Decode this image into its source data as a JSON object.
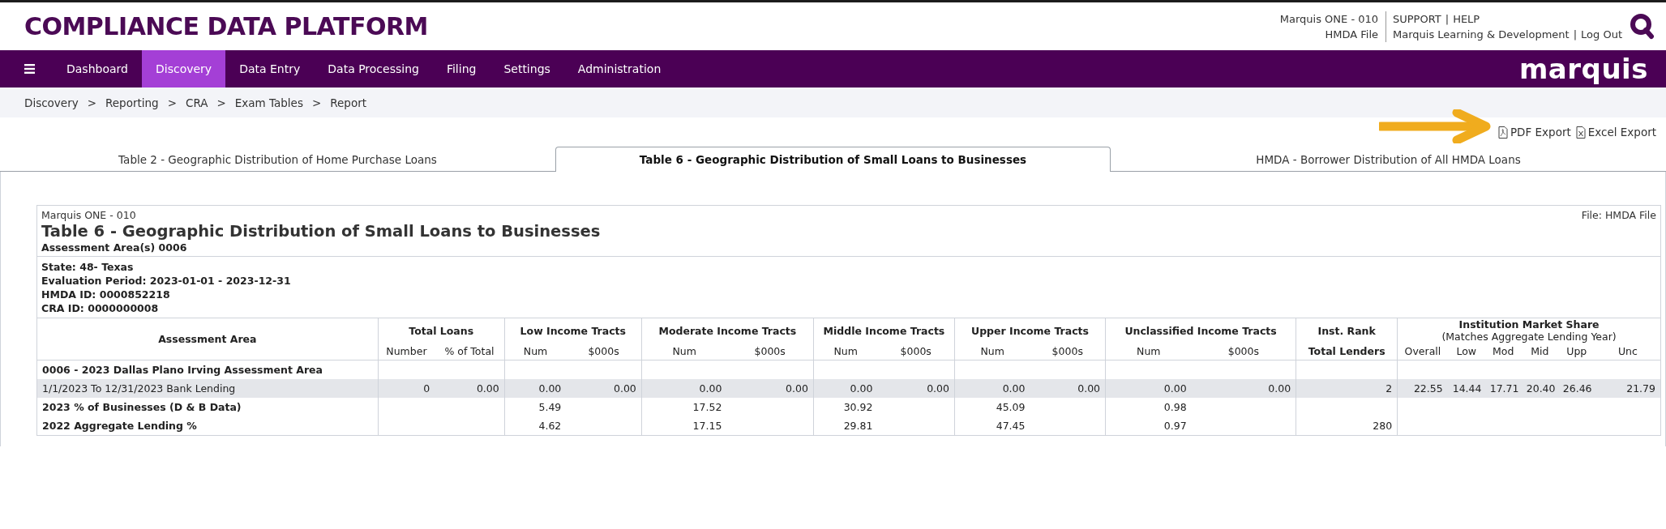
{
  "header": {
    "title": "COMPLIANCE DATA PLATFORM",
    "account": [
      "Marquis ONE - 010",
      "HMDA File"
    ],
    "link_separator": "|",
    "link_rows": [
      [
        "SUPPORT",
        "HELP"
      ],
      [
        "Marquis Learning & Development",
        "Log Out"
      ]
    ],
    "logo": "marquis"
  },
  "nav": {
    "items": [
      {
        "label": "Dashboard",
        "selected": false
      },
      {
        "label": "Discovery",
        "selected": true
      },
      {
        "label": "Data Entry",
        "selected": false
      },
      {
        "label": "Data Processing",
        "selected": false
      },
      {
        "label": "Filing",
        "selected": false
      },
      {
        "label": "Settings",
        "selected": false
      },
      {
        "label": "Administration",
        "selected": false
      }
    ]
  },
  "breadcrumb": {
    "separator": ">",
    "items": [
      "Discovery",
      "Reporting",
      "CRA",
      "Exam Tables",
      "Report"
    ]
  },
  "exports": [
    {
      "label": "PDF Export",
      "kind": "pdf"
    },
    {
      "label": "Excel Export",
      "kind": "excel"
    }
  ],
  "tabs": [
    {
      "label": "Table 2 - Geographic Distribution of Home Purchase Loans",
      "selected": false
    },
    {
      "label": "Table 6 - Geographic Distribution of Small Loans to Businesses",
      "selected": true
    },
    {
      "label": "HMDA - Borrower Distribution of All HMDA Loans",
      "selected": false
    }
  ],
  "report": {
    "institution": "Marquis ONE - 010",
    "file": "File: HMDA File",
    "title": "Table 6 - Geographic Distribution of Small Loans to Businesses",
    "subtitle": "Assessment Area(s) 0006",
    "details": [
      "State: 48- Texas",
      "Evaluation Period: 2023-01-01 - 2023-12-31",
      "HMDA ID: 0000852218",
      "CRA ID: 0000000008"
    ],
    "table": {
      "groups": [
        {
          "label": "Assessment Area"
        },
        {
          "label": "Total Loans",
          "columns": [
            "Number",
            "% of Total"
          ]
        },
        {
          "label": "Low Income Tracts",
          "columns": [
            "Num",
            "$000s"
          ]
        },
        {
          "label": "Moderate Income Tracts",
          "columns": [
            "Num",
            "$000s"
          ]
        },
        {
          "label": "Middle Income Tracts",
          "columns": [
            "Num",
            "$000s"
          ]
        },
        {
          "label": "Upper Income Tracts",
          "columns": [
            "Num",
            "$000s"
          ]
        },
        {
          "label": "Unclassified Income Tracts",
          "columns": [
            "Num",
            "$000s"
          ]
        },
        {
          "label": "Inst. Rank",
          "columns": [
            "Total Lenders"
          ]
        },
        {
          "label": "Institution Market Share",
          "note": "(Matches Aggregate Lending Year)",
          "columns": [
            "Overall",
            "Low",
            "Mod",
            "Mid",
            "Upp",
            "Unc"
          ]
        }
      ],
      "rows": [
        {
          "kind": "section",
          "cells": [
            "0006 - 2023 Dallas Plano Irving Assessment Area",
            null,
            null,
            null,
            null,
            null,
            null,
            null,
            null,
            null,
            null,
            null,
            null,
            null,
            null,
            null,
            null,
            null,
            null,
            null
          ]
        },
        {
          "kind": "data",
          "cells": [
            "1/1/2023 To 12/31/2023 Bank Lending",
            "0",
            "0.00",
            "0.00",
            "0.00",
            "0.00",
            "0.00",
            "0.00",
            "0.00",
            "0.00",
            "0.00",
            "0.00",
            "0.00",
            "2",
            "22.55",
            "14.44",
            "17.71",
            "20.40",
            "26.46",
            "21.79"
          ]
        },
        {
          "kind": "summary",
          "cells": [
            "2023 % of Businesses (D & B Data)",
            null,
            null,
            "5.49",
            null,
            "17.52",
            null,
            "30.92",
            null,
            "45.09",
            null,
            "0.98",
            null,
            null,
            null,
            null,
            null,
            null,
            null,
            null
          ]
        },
        {
          "kind": "summary",
          "cells": [
            "2022 Aggregate Lending %",
            null,
            null,
            "4.62",
            null,
            "17.15",
            null,
            "29.81",
            null,
            "47.45",
            null,
            "0.97",
            null,
            "280",
            null,
            null,
            null,
            null,
            null,
            null
          ]
        }
      ]
    }
  }
}
